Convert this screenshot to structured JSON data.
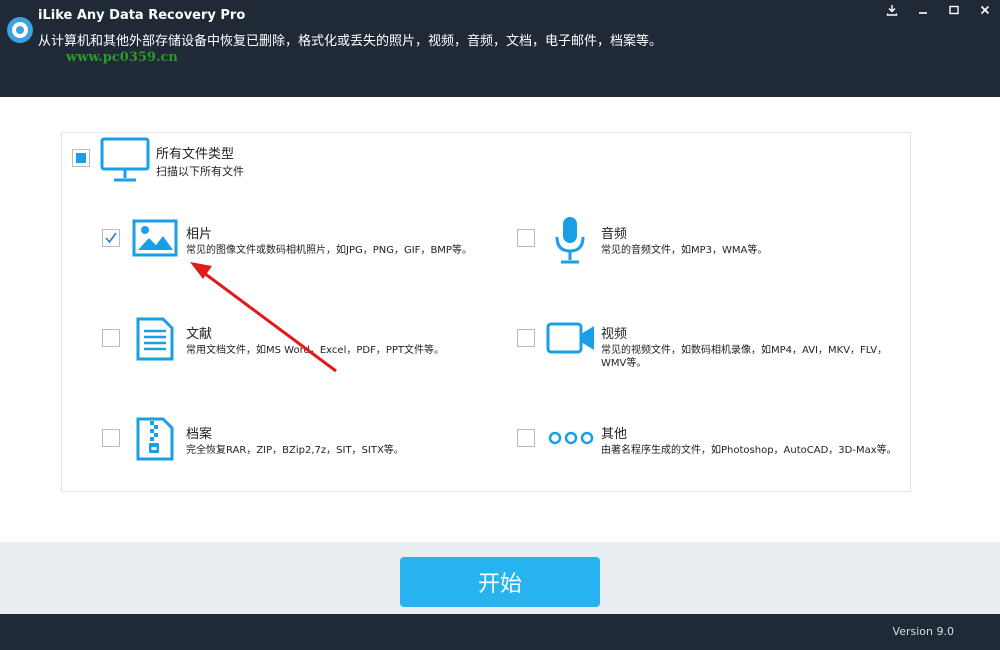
{
  "window": {
    "title": "iLike Any Data Recovery Pro",
    "subtitle": "从计算机和其他外部存储设备中恢复已删除，格式化或丢失的照片，视频，音频，文档，电子邮件，档案等。",
    "watermark": "www.pc0359.cn"
  },
  "all_types": {
    "title": "所有文件类型",
    "desc": "扫描以下所有文件"
  },
  "items": {
    "photo": {
      "title": "相片",
      "desc": "常见的图像文件或数码相机照片，如JPG，PNG，GIF，BMP等。",
      "checked": true
    },
    "audio": {
      "title": "音频",
      "desc": "常见的音频文件，如MP3，WMA等。",
      "checked": false
    },
    "document": {
      "title": "文献",
      "desc": "常用文档文件，如MS Word，Excel，PDF，PPT文件等。",
      "checked": false
    },
    "video": {
      "title": "视频",
      "desc": "常见的视频文件，如数码相机录像，如MP4，AVI，MKV，FLV，WMV等。",
      "checked": false
    },
    "archive": {
      "title": "档案",
      "desc": "完全恢复RAR，ZIP，BZip2,7z，SIT，SITX等。",
      "checked": false
    },
    "other": {
      "title": "其他",
      "desc": "由著名程序生成的文件，如Photoshop，AutoCAD，3D-Max等。",
      "checked": false
    }
  },
  "start_button": "开始",
  "version": "Version 9.0",
  "colors": {
    "accent": "#1a9ee6",
    "button": "#27b3ef",
    "header": "#1f2a36"
  }
}
